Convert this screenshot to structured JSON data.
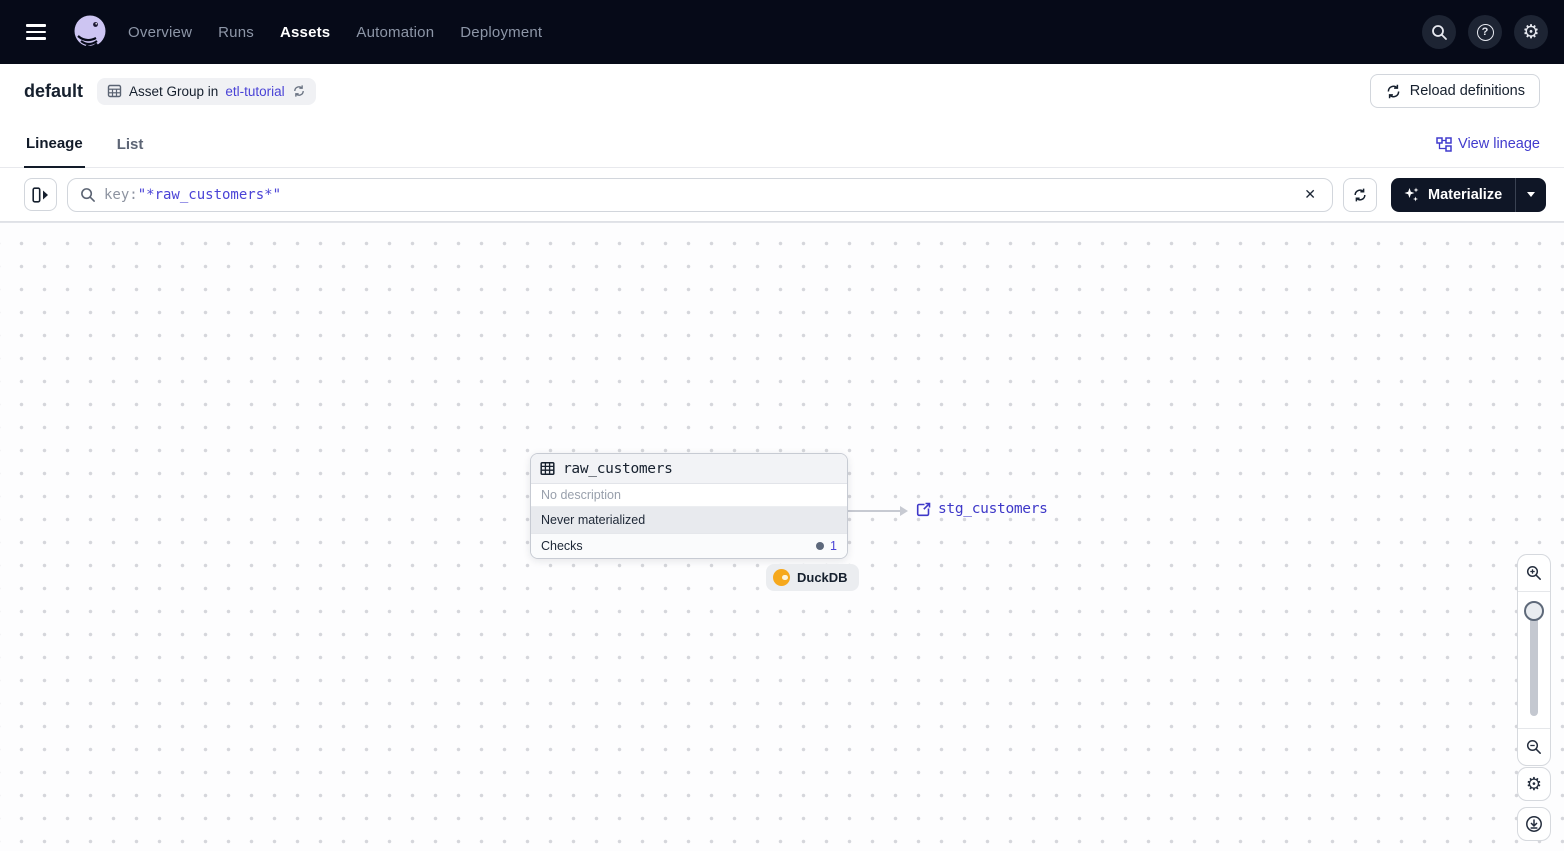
{
  "navbar": {
    "items": [
      {
        "label": "Overview",
        "active": false
      },
      {
        "label": "Runs",
        "active": false
      },
      {
        "label": "Assets",
        "active": true
      },
      {
        "label": "Automation",
        "active": false
      },
      {
        "label": "Deployment",
        "active": false
      }
    ],
    "icons": {
      "help_glyph": "?",
      "gear_glyph": "⚙"
    }
  },
  "header": {
    "title": "default",
    "badge": {
      "label": "Asset Group in",
      "link": "etl-tutorial"
    },
    "reload_label": "Reload definitions"
  },
  "tabs": {
    "items": [
      {
        "label": "Lineage",
        "active": true
      },
      {
        "label": "List",
        "active": false
      }
    ],
    "view_lineage_label": "View lineage"
  },
  "filter": {
    "query_key": "key:",
    "query_value": "\"*raw_customers*\"",
    "clear_glyph": "✕",
    "materialize_label": "Materialize"
  },
  "graph": {
    "node": {
      "title": "raw_customers",
      "description": "No description",
      "status": "Never materialized",
      "checks_label": "Checks",
      "checks_count": "1"
    },
    "kind_badge": {
      "label": "DuckDB"
    },
    "downstream": {
      "label": "stg_customers"
    }
  },
  "controls": {
    "gear_glyph": "⚙"
  },
  "colors": {
    "navbar_bg": "#060a18",
    "accent_indigo": "#4a43d6",
    "link_indigo": "#3e38c8",
    "dark_text": "#16202e",
    "materialize_bg": "#0f1626",
    "duckdb_yellow": "#f6a81c",
    "status_row_bg": "#e8eaee",
    "edge_gray": "#c7cad2"
  }
}
